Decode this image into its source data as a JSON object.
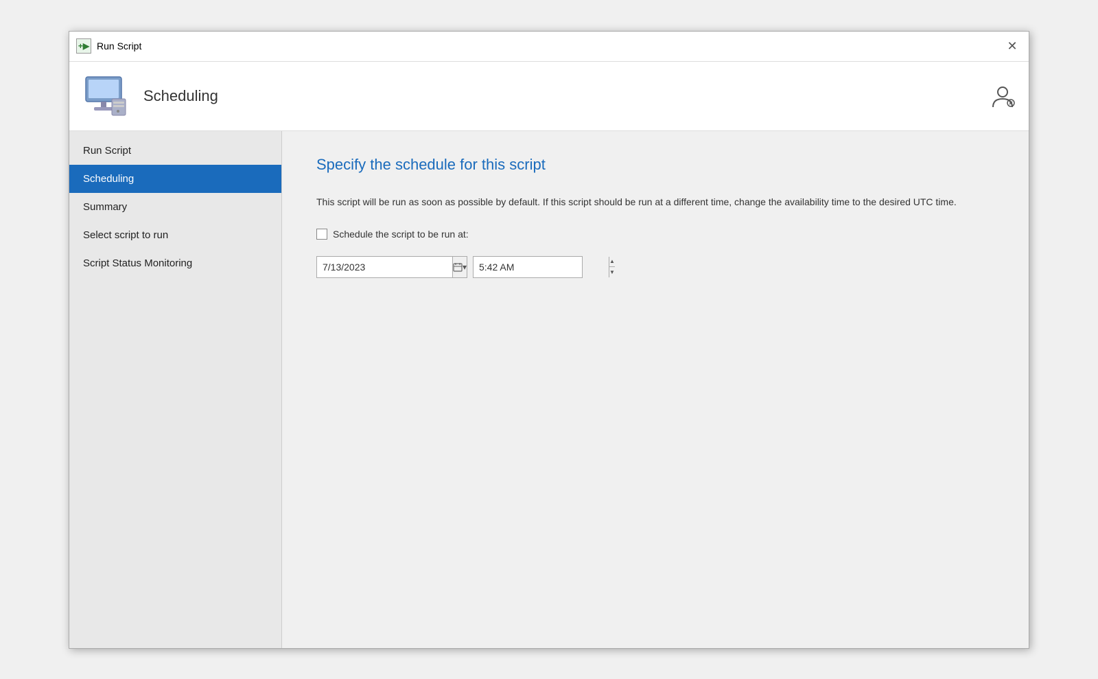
{
  "titleBar": {
    "icon_label": "+-",
    "title": "Run Script",
    "close_label": "✕"
  },
  "header": {
    "title": "Scheduling",
    "user_icon": "👤"
  },
  "sidebar": {
    "items": [
      {
        "id": "run-script",
        "label": "Run Script",
        "active": false
      },
      {
        "id": "scheduling",
        "label": "Scheduling",
        "active": true
      },
      {
        "id": "summary",
        "label": "Summary",
        "active": false
      },
      {
        "id": "select-script",
        "label": "Select script to run",
        "active": false
      },
      {
        "id": "script-status",
        "label": "Script Status Monitoring",
        "active": false
      }
    ]
  },
  "main": {
    "section_title": "Specify the schedule for this script",
    "description": "This script will be run as soon as possible by default. If this script should be run at a different time, change the availability time to the desired UTC time.",
    "schedule_checkbox_label": "Schedule the script to be run at:",
    "date_value": "7/13/2023",
    "time_value": "5:42 AM"
  }
}
